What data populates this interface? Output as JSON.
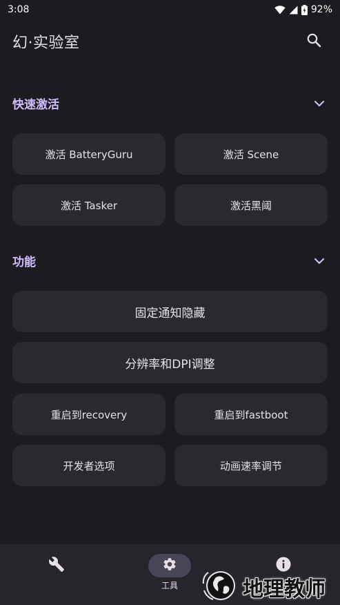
{
  "status_bar": {
    "time": "3:08",
    "battery": "92%",
    "icons": [
      "wifi-icon",
      "cell-signal-icon",
      "battery-icon"
    ]
  },
  "app_bar": {
    "title": "幻·实验室",
    "search_icon": "search-icon"
  },
  "quick_activate": {
    "title": "快速激活",
    "items": [
      {
        "label": "激活 BatteryGuru"
      },
      {
        "label": "激活 Scene"
      },
      {
        "label": "激活 Tasker"
      },
      {
        "label": "激活黑阈"
      }
    ]
  },
  "features": {
    "title": "功能",
    "items": [
      {
        "label": "固定通知隐藏"
      },
      {
        "label": "分辨率和DPI调整"
      },
      {
        "label": "重启到recovery"
      },
      {
        "label": "重启到fastboot"
      },
      {
        "label": "开发者选项"
      },
      {
        "label": "动画速率调节"
      }
    ]
  },
  "bottom_nav": {
    "items": [
      {
        "icon": "wrench-icon",
        "label": ""
      },
      {
        "icon": "gear-icon",
        "label": "工具",
        "active": true
      },
      {
        "icon": "info-icon",
        "label": ""
      }
    ]
  },
  "watermark": {
    "text": "地理教师"
  },
  "colors": {
    "background": "#1c1b1f",
    "surface": "#2b2930",
    "accent": "#d0bcff",
    "nav_background": "#27252b",
    "nav_indicator": "#4a4458"
  }
}
